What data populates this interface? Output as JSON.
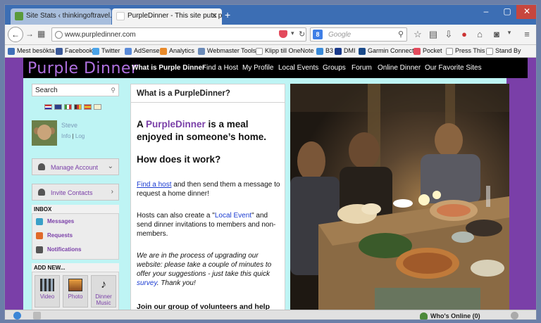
{
  "browser": {
    "tabs": [
      {
        "title": "Site Stats ‹ thinkingoftravel..."
      },
      {
        "title": "PurpleDinner - This site puts p..."
      }
    ],
    "url": "www.purpledinner.com",
    "search_placeholder": "Google",
    "search_engine_letter": "8",
    "bookmarks": [
      {
        "label": "Mest besökta",
        "color": "#3f6fb8"
      },
      {
        "label": "Facebook",
        "color": "#3b5998"
      },
      {
        "label": "Twitter",
        "color": "#4aa3e8"
      },
      {
        "label": "AdSense",
        "color": "#5a8ad8"
      },
      {
        "label": "Analytics",
        "color": "#e88a2a"
      },
      {
        "label": "Webmaster Tools",
        "color": "#6a8ab8"
      },
      {
        "label": "Klipp till OneNote",
        "color": "#ffffff"
      },
      {
        "label": "B3",
        "color": "#3a8ad8"
      },
      {
        "label": "DMI",
        "color": "#1a3a8a"
      },
      {
        "label": "Garmin Connect",
        "color": "#1a4a8a"
      },
      {
        "label": "Pocket",
        "color": "#e34a5c"
      },
      {
        "label": "Press This",
        "color": "#ffffff"
      },
      {
        "label": "Stand By",
        "color": "#ffffff"
      }
    ]
  },
  "site": {
    "logo": "Purple Dinner",
    "nav": [
      "What is Purple Dinner",
      "Find a Host",
      "My Profile",
      "Local Events",
      "Groups",
      "Forum",
      "Online Dinner",
      "Our Favorite Sites"
    ]
  },
  "sidebar": {
    "search_label": "Search",
    "user_name": "Steve",
    "user_links": [
      "Info",
      "Log"
    ],
    "menu": [
      {
        "label": "Manage Account",
        "chevron": "⌄"
      },
      {
        "label": "Invite Contacts",
        "chevron": "›"
      }
    ],
    "inbox_title": "INBOX",
    "inbox_items": [
      {
        "label": "Messages",
        "color": "#3aa0c8"
      },
      {
        "label": "Requests",
        "color": "#e06a2a"
      },
      {
        "label": "Notifications",
        "color": "#555555"
      }
    ],
    "add_title": "ADD NEW...",
    "add_items": [
      {
        "label": "Video"
      },
      {
        "label": "Photo"
      },
      {
        "label": "Dinner Music"
      }
    ]
  },
  "article": {
    "heading": "What is a PurpleDinner?",
    "intro_a": "A ",
    "intro_brand": "PurpleDinner",
    "intro_b": " is a meal enjoyed in someone’s home.",
    "how": "How does it work?",
    "p1_link": "Find a host",
    "p1_text": " and then send them a message to request a home dinner!",
    "p2_a": "Hosts can also create a \"",
    "p2_link": "Local Event",
    "p2_b": "\" and send dinner invitations to members and non-members.",
    "p3_a": "We are in the process of upgrading our website: please take a couple of minutes to offer your suggestions - just take this quick ",
    "p3_link": "survey",
    "p3_b": ". Thank you!",
    "p4": "Join our group of volunteers and help"
  },
  "statusbar": {
    "whos_online": "Who's Online (0)"
  }
}
